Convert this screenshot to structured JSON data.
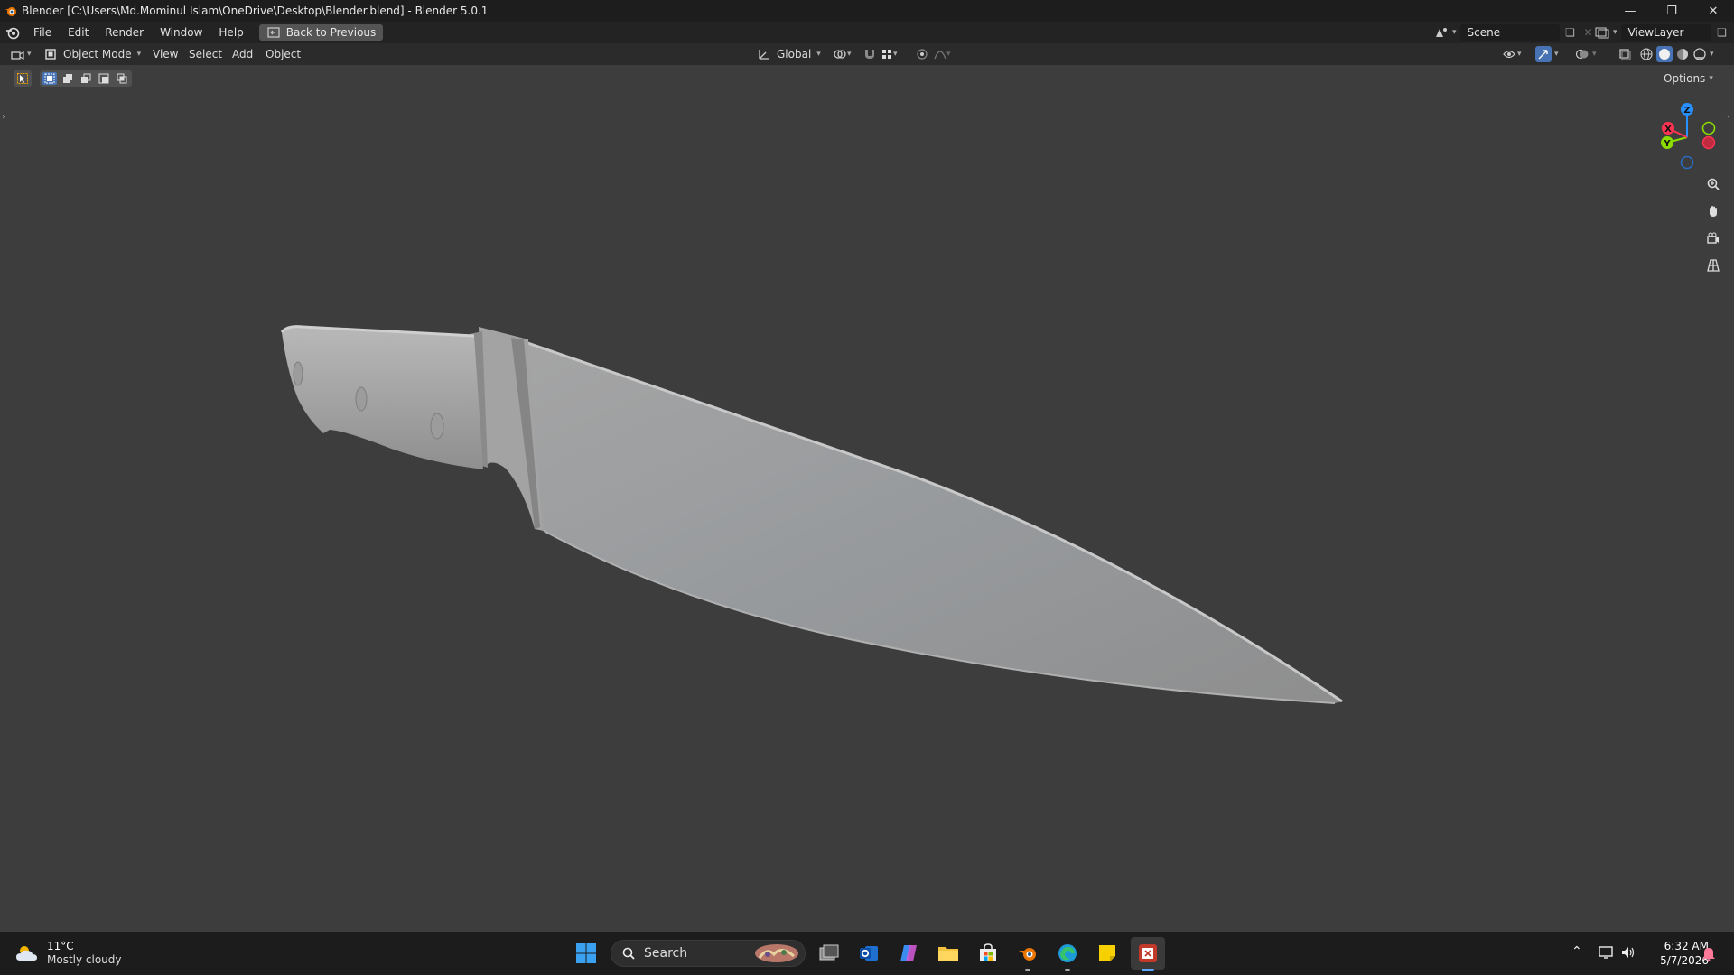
{
  "window": {
    "title": "Blender [C:\\Users\\Md.Mominul Islam\\OneDrive\\Desktop\\Blender.blend] - Blender 5.0.1"
  },
  "menu": {
    "items": [
      "File",
      "Edit",
      "Render",
      "Window",
      "Help"
    ],
    "back_button": "Back to Previous"
  },
  "workspace": {
    "scene_label": "Scene",
    "view_layer_label": "ViewLayer"
  },
  "viewport_header": {
    "mode": "Object Mode",
    "menus": [
      "View",
      "Select",
      "Add",
      "Object"
    ],
    "transform_orientation": "Global",
    "options_label": "Options"
  },
  "gizmo": {
    "axes": [
      "X",
      "Y",
      "Z"
    ],
    "colors": {
      "x": "#ff3352",
      "y": "#8bdc00",
      "z": "#2890ff"
    }
  },
  "taskbar": {
    "weather_temp": "11°C",
    "weather_desc": "Mostly cloudy",
    "search_placeholder": "Search",
    "time": "6:32 AM",
    "date": "5/7/2026"
  }
}
